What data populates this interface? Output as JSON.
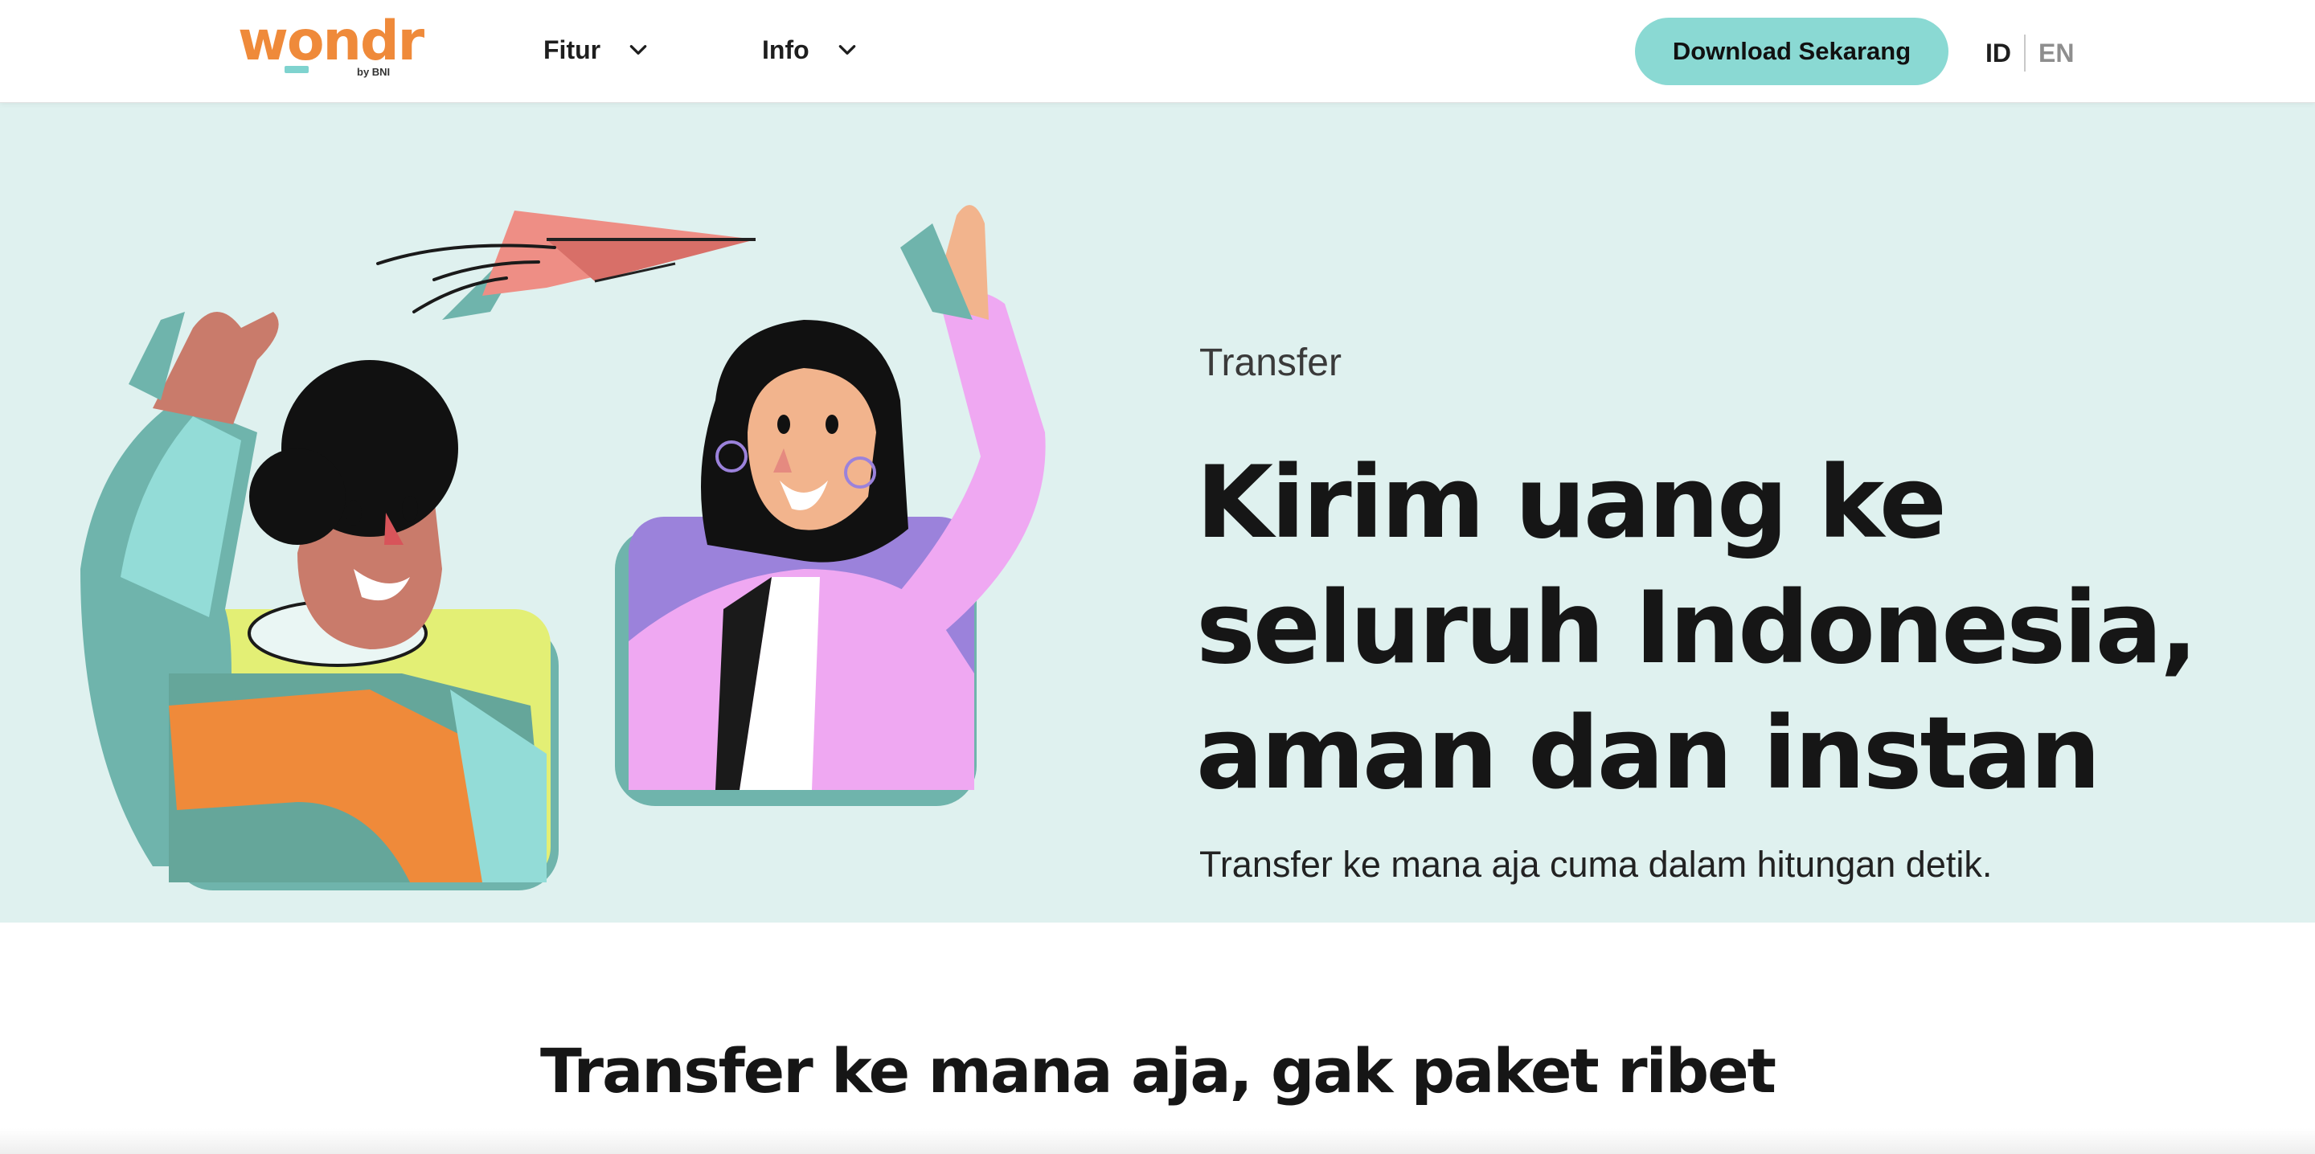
{
  "header": {
    "logo_text": "wondr",
    "logo_sub": "by BNI",
    "nav": [
      {
        "label": "Fitur",
        "icon": "chevron-down-icon"
      },
      {
        "label": "Info",
        "icon": "chevron-down-icon"
      }
    ],
    "download_label": "Download Sekarang",
    "lang_active": "ID",
    "lang_other": "EN"
  },
  "hero": {
    "eyebrow": "Transfer",
    "headline": "Kirim uang ke\nseluruh Indonesia,\naman dan instan",
    "subline": "Transfer ke mana aja cuma dalam hitungan detik."
  },
  "section": {
    "title": "Transfer ke mana aja, gak paket ribet"
  },
  "colors": {
    "accent": "#8ad9d3",
    "hero_bg": "#dff1ef",
    "brand_orange": "#ef8a3a"
  }
}
